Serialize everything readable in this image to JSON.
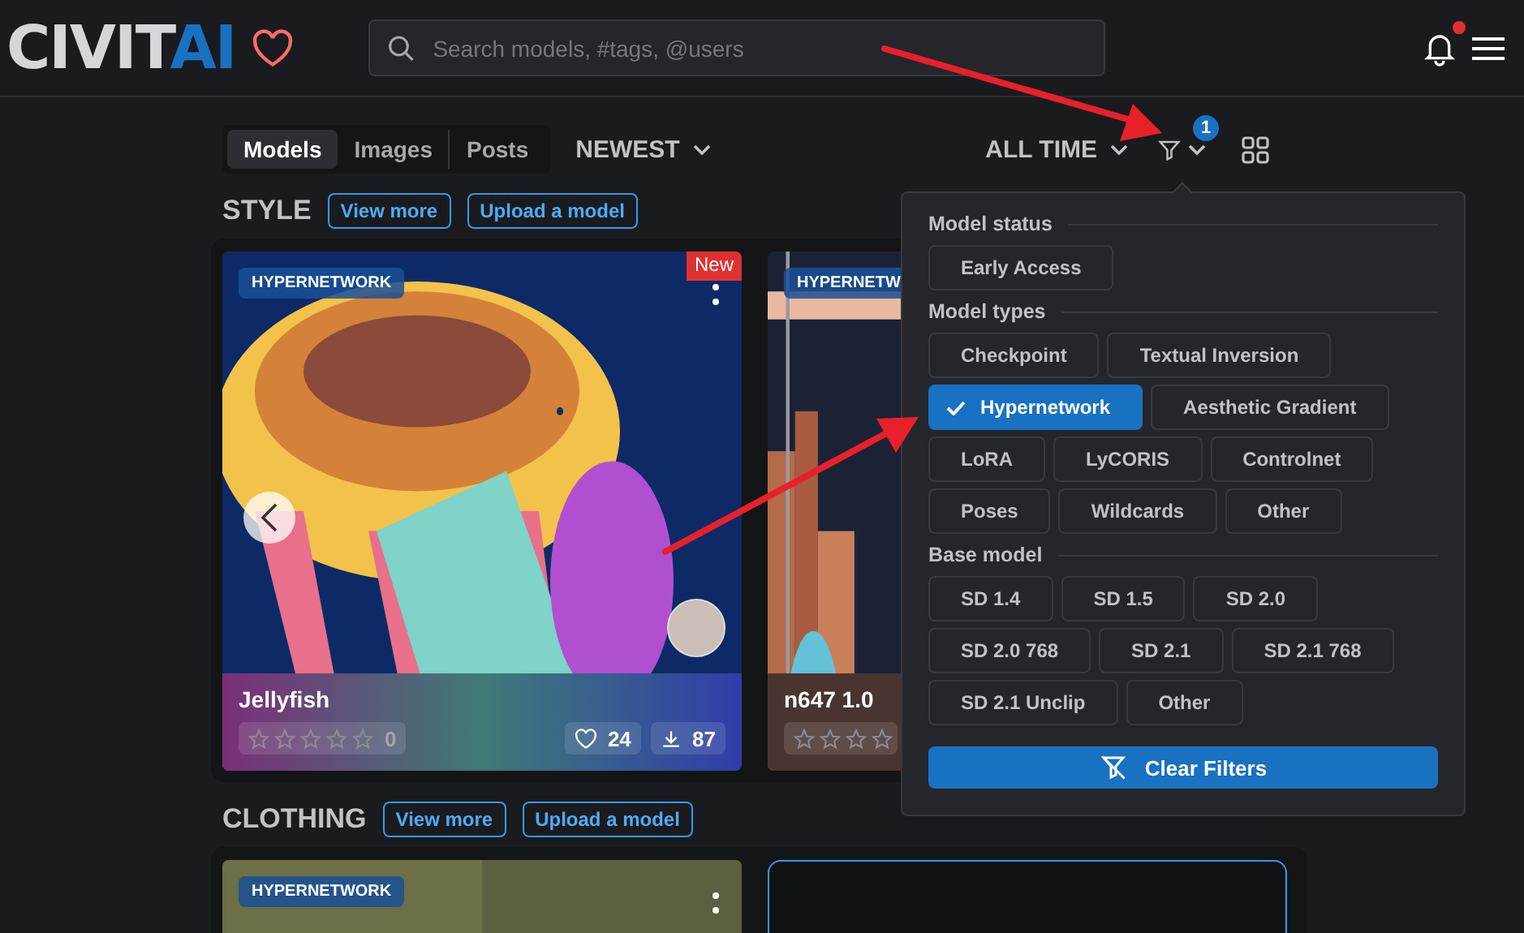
{
  "header": {
    "logo": {
      "part_1": "CIVIT",
      "part_2": "AI"
    },
    "search": {
      "placeholder": "Search models, #tags, @users"
    },
    "notifications": {
      "unread": true
    }
  },
  "toolbar": {
    "tabs": [
      {
        "label": "Models",
        "selected": true
      },
      {
        "label": "Images",
        "selected": false
      },
      {
        "label": "Posts",
        "selected": false
      }
    ],
    "sort": "NEWEST",
    "period": "ALL TIME",
    "filter_count": "1"
  },
  "sections": [
    {
      "title": "STYLE",
      "view_more": "View more",
      "upload": "Upload a model",
      "cards": [
        {
          "kind": "model",
          "type": "HYPERNETWORK",
          "badge": "New",
          "title": "Jellyfish",
          "stars": 0,
          "rating_count": "0",
          "likes": "24",
          "downloads": "87"
        },
        {
          "kind": "model",
          "type": "HYPERNETW",
          "title": "n647 1.0",
          "stars": 0
        }
      ]
    },
    {
      "title": "CLOTHING",
      "view_more": "View more",
      "upload": "Upload a model",
      "cards": [
        {
          "kind": "model",
          "type": "HYPERNETWORK"
        },
        {
          "kind": "empty"
        }
      ]
    }
  ],
  "filter_popover": {
    "groups": [
      {
        "title": "Model status",
        "options": [
          {
            "label": "Early Access",
            "selected": false
          }
        ]
      },
      {
        "title": "Model types",
        "options": [
          {
            "label": "Checkpoint",
            "selected": false
          },
          {
            "label": "Textual Inversion",
            "selected": false
          },
          {
            "label": "Hypernetwork",
            "selected": true
          },
          {
            "label": "Aesthetic Gradient",
            "selected": false
          },
          {
            "label": "LoRA",
            "selected": false
          },
          {
            "label": "LyCORIS",
            "selected": false
          },
          {
            "label": "Controlnet",
            "selected": false
          },
          {
            "label": "Poses",
            "selected": false
          },
          {
            "label": "Wildcards",
            "selected": false
          },
          {
            "label": "Other",
            "selected": false
          }
        ]
      },
      {
        "title": "Base model",
        "options": [
          {
            "label": "SD 1.4",
            "selected": false
          },
          {
            "label": "SD 1.5",
            "selected": false
          },
          {
            "label": "SD 2.0",
            "selected": false
          },
          {
            "label": "SD 2.0 768",
            "selected": false
          },
          {
            "label": "SD 2.1",
            "selected": false
          },
          {
            "label": "SD 2.1 768",
            "selected": false
          },
          {
            "label": "SD 2.1 Unclip",
            "selected": false
          },
          {
            "label": "Other",
            "selected": false
          }
        ]
      }
    ],
    "clear_button": "Clear Filters"
  }
}
